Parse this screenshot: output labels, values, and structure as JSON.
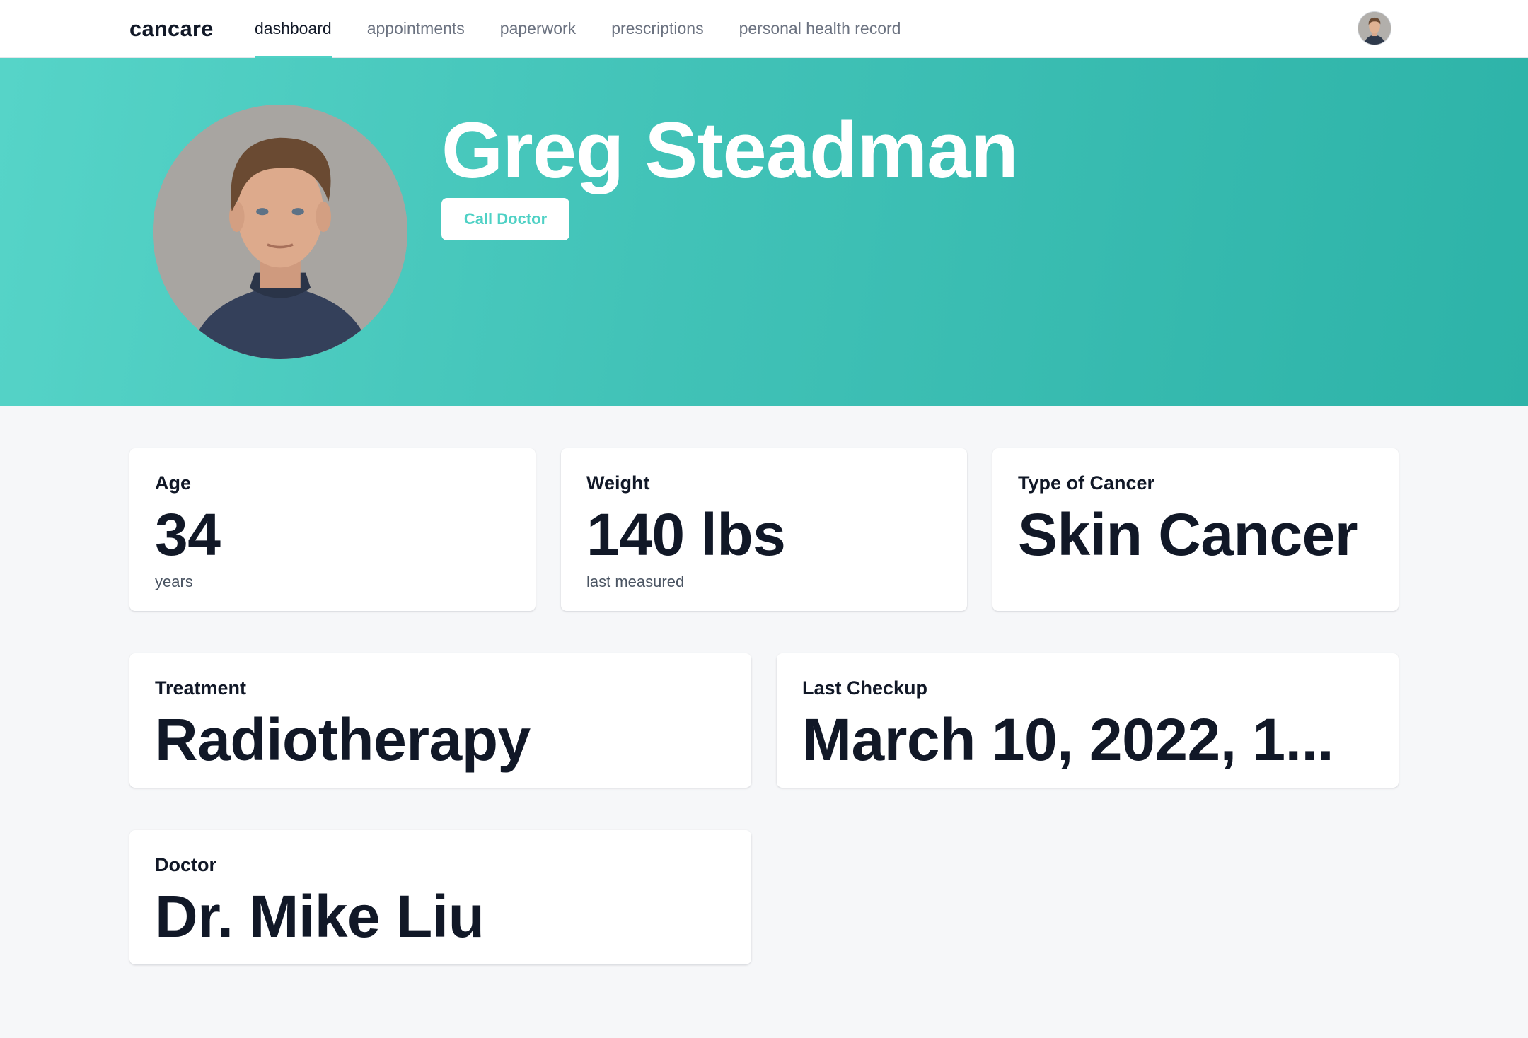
{
  "nav": {
    "brand": "cancare",
    "items": [
      {
        "label": "dashboard",
        "active": true
      },
      {
        "label": "appointments",
        "active": false
      },
      {
        "label": "paperwork",
        "active": false
      },
      {
        "label": "prescriptions",
        "active": false
      },
      {
        "label": "personal health record",
        "active": false
      }
    ]
  },
  "hero": {
    "name": "Greg Steadman",
    "call_button": "Call Doctor"
  },
  "cards": {
    "age": {
      "label": "Age",
      "value": "34",
      "sub": "years"
    },
    "weight": {
      "label": "Weight",
      "value": "140 lbs",
      "sub": "last measured"
    },
    "cancer": {
      "label": "Type of Cancer",
      "value": "Skin Cancer"
    },
    "treatment": {
      "label": "Treatment",
      "value": "Radiotherapy"
    },
    "checkup": {
      "label": "Last Checkup",
      "value": "March 10, 2022, 1..."
    },
    "doctor": {
      "label": "Doctor",
      "value": "Dr. Mike Liu"
    }
  },
  "colors": {
    "accent": "#4fd1c5",
    "hero_start": "#56d4c8",
    "hero_end": "#2db3a8",
    "text_dark": "#111827",
    "page_bg": "#f6f7f9"
  }
}
